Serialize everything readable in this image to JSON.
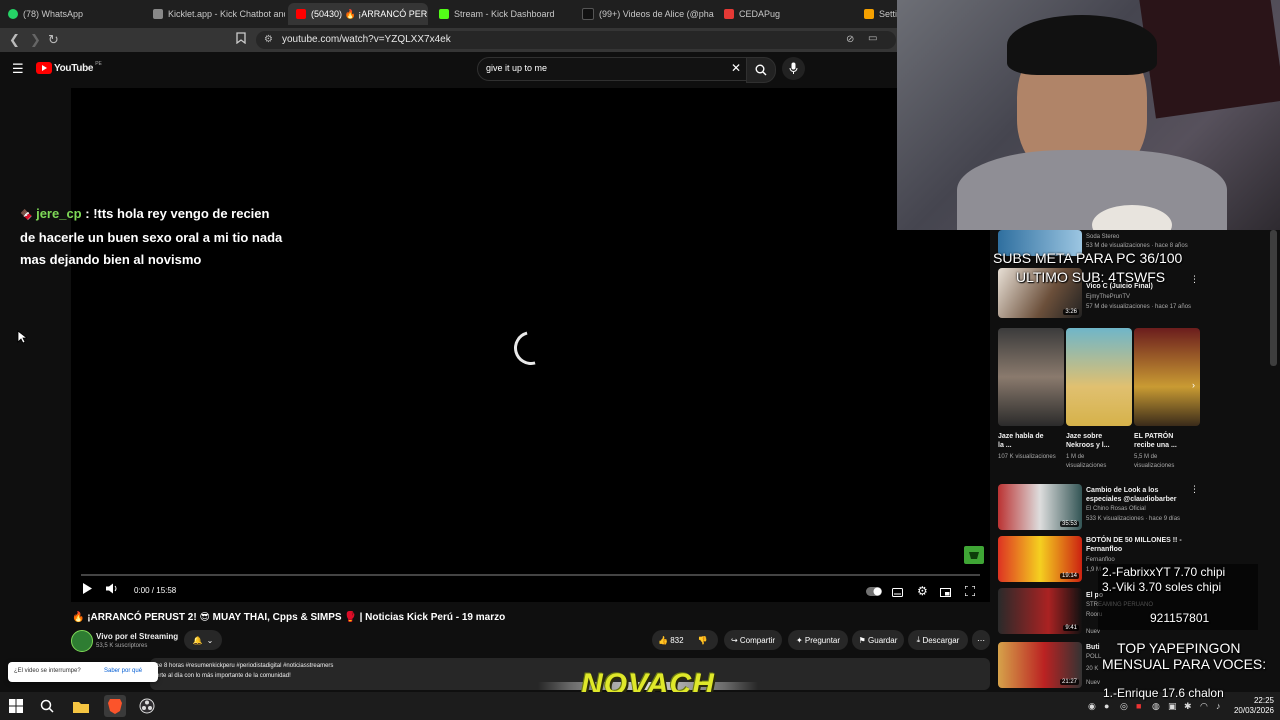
{
  "browser": {
    "tabs": [
      {
        "label": "(78) WhatsApp",
        "color": "#25d366"
      },
      {
        "label": "Kicklet.app - Kick Chatbot and",
        "color": "#888888"
      },
      {
        "label": "(50430) 🔥 ¡ARRANCÓ PER",
        "color": "#ff0000",
        "active": true
      },
      {
        "label": "Stream - Kick Dashboard",
        "color": "#53fc18"
      },
      {
        "label": "(99+) Videos de Alice (@phaito",
        "color": "#111111"
      },
      {
        "label": "CEDAPug",
        "color": "#e53935"
      },
      {
        "label": "Setti",
        "color": "#f4a000"
      }
    ],
    "url": "youtube.com/watch?v=YZQLXX7x4ek"
  },
  "youtube": {
    "logo": "YouTube",
    "logo_region": "PE",
    "search_query": "give it up to me",
    "player": {
      "time": "0:00 / 15:58"
    },
    "video_title": "🔥 ¡ARRANCÓ PERUST 2! 😎 MUAY THAI, Cpps & SIMPS 🥊 | Noticias Kick Perú - 19 marzo",
    "channel": {
      "name": "Vivo por el Streaming",
      "subs": "53,5 K suscriptores"
    },
    "actions": {
      "likes": "832",
      "share": "Compartir",
      "ask": "Preguntar",
      "save": "Guardar",
      "download": "Descargar"
    },
    "description": {
      "line1": "ce 8 horas  #resumenkickperu #periodistadigital #noticiasstreamers",
      "line2": "erte al día con lo más importante de la comunidad!"
    },
    "interrupt_prompt": {
      "question": "¿El video se interrumpe?",
      "link": "Saber por qué"
    }
  },
  "sidebar": {
    "videos": [
      {
        "title": "",
        "channel": "Soda Stereo",
        "meta": "53 M de visualizaciones · hace 8 años"
      },
      {
        "title": "Vico C (Juicio Final)",
        "channel": "EjmyThePrunTV",
        "meta": "57 M de visualizaciones · hace 17 años",
        "duration": "3:26"
      },
      {
        "title": "Cambio de Look a los especiales @claudiobarber",
        "channel": "El Chino Rosas Oficial",
        "meta": "533 K visualizaciones · hace 9 días",
        "duration": "35:53"
      },
      {
        "title": "BOTÓN DE 50 MILLONES !! - Fernanfloo",
        "channel": "Fernanfloo",
        "meta": "1,9 M",
        "duration": "19:14"
      },
      {
        "title": "El po",
        "channel": "STREAMING PERUANO",
        "meta": "Rooru",
        "duration": "9:41"
      },
      {
        "title": "Buti",
        "channel": "POLL",
        "meta": "20 K",
        "duration": "21:27"
      }
    ],
    "shorts": [
      {
        "title": "Jaze habla de la ...",
        "views": "107 K visualizaciones"
      },
      {
        "title": "Jaze sobre Nekroos y l...",
        "views": "1 M de visualizaciones"
      },
      {
        "title": "EL PATRÓN recibe una ...",
        "views": "5,5 M de visualizaciones"
      }
    ],
    "new_badge": "Nuev"
  },
  "overlays": {
    "subs_goal": "SUBS META PARA PC 36/100",
    "last_sub": "ULTIMO SUB: 4TSWFS",
    "donations": [
      "2.-FabrixxYT 7.70 chipi",
      "3.-Viki 3.70 soles chipi"
    ],
    "phone": "921157801",
    "top_heading": [
      "TOP YAPEPINGON",
      "MENSUAL PARA VOCES:"
    ],
    "top_first": "1.-Enrique 17.6 chalon",
    "brand": "NOVACH"
  },
  "chat": {
    "user": "jere_cp",
    "message_lines": [
      ": !tts hola rey vengo de recien",
      "de hacerle un buen sexo oral a mi tio nada",
      "mas dejando bien al novismo"
    ]
  },
  "taskbar": {
    "time": "22:25",
    "date": "20/03/2026"
  },
  "colors": {
    "accent": "#ff0000",
    "kick_green": "#53fc18",
    "background": "#0f0f0f"
  }
}
